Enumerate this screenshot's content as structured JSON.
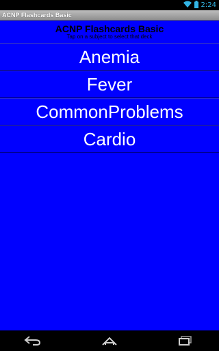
{
  "status_bar": {
    "time": "2:24",
    "icons": [
      "wifi-icon",
      "battery-icon"
    ]
  },
  "title_bar": {
    "app_name": "ACNP Flashcards Basic"
  },
  "header": {
    "title": "ACNP Flashcards Basic",
    "subtitle": "Tap on a subject to select that deck"
  },
  "decks": [
    {
      "label": "Anemia"
    },
    {
      "label": "Fever"
    },
    {
      "label": "CommonProblems"
    },
    {
      "label": "Cardio"
    }
  ],
  "nav_bar": {
    "icons": [
      "back-icon",
      "home-icon",
      "recents-icon"
    ]
  },
  "colors": {
    "background": "#0000ff",
    "status_accent": "#33b5e5",
    "item_text": "#ffffff"
  }
}
